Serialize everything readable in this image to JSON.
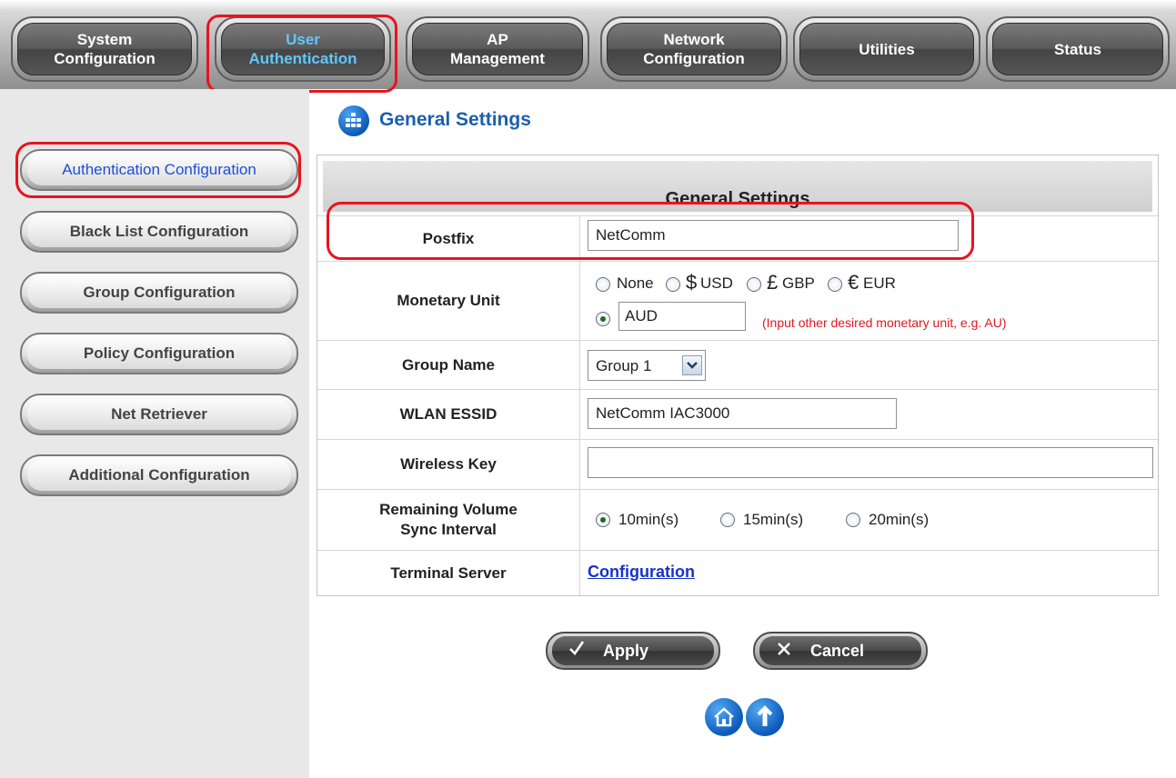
{
  "nav": {
    "tabs": [
      {
        "label": "System\nConfiguration"
      },
      {
        "label": "User\nAuthentication"
      },
      {
        "label": "AP\nManagement"
      },
      {
        "label": "Network\nConfiguration"
      },
      {
        "label": "Utilities"
      },
      {
        "label": "Status"
      }
    ]
  },
  "sidebar": {
    "items": [
      {
        "label": "Authentication Configuration"
      },
      {
        "label": "Black List Configuration"
      },
      {
        "label": "Group Configuration"
      },
      {
        "label": "Policy Configuration"
      },
      {
        "label": "Net Retriever"
      },
      {
        "label": "Additional Configuration"
      }
    ]
  },
  "page": {
    "title": "General Settings",
    "panel_title": "General Settings"
  },
  "form": {
    "postfix": {
      "label": "Postfix",
      "value": "NetComm"
    },
    "monetary": {
      "label": "Monetary Unit",
      "options": [
        {
          "label": "None",
          "symbol": ""
        },
        {
          "label": "USD",
          "symbol": "$"
        },
        {
          "label": "GBP",
          "symbol": "£"
        },
        {
          "label": "EUR",
          "symbol": "€"
        }
      ],
      "other_value": "AUD",
      "hint": "(Input other desired monetary unit, e.g. AU)",
      "selected": "other"
    },
    "group_name": {
      "label": "Group Name",
      "selected": "Group 1"
    },
    "wlan_essid": {
      "label": "WLAN ESSID",
      "value": "NetComm IAC3000"
    },
    "wireless_key": {
      "label": "Wireless Key",
      "value": ""
    },
    "sync_interval": {
      "label": "Remaining Volume\nSync Interval",
      "options": [
        "10min(s)",
        "15min(s)",
        "20min(s)"
      ],
      "selected": "10min(s)"
    },
    "terminal_server": {
      "label": "Terminal Server",
      "link": "Configuration"
    }
  },
  "actions": {
    "apply": "Apply",
    "cancel": "Cancel"
  },
  "colors": {
    "highlight": "#e8141e",
    "active_tab_text": "#5fc8ff",
    "link": "#1533c8",
    "hint": "#e0181e"
  },
  "icons": {
    "title": "grid-globe-icon",
    "home": "home-icon",
    "top": "up-arrow-icon"
  }
}
